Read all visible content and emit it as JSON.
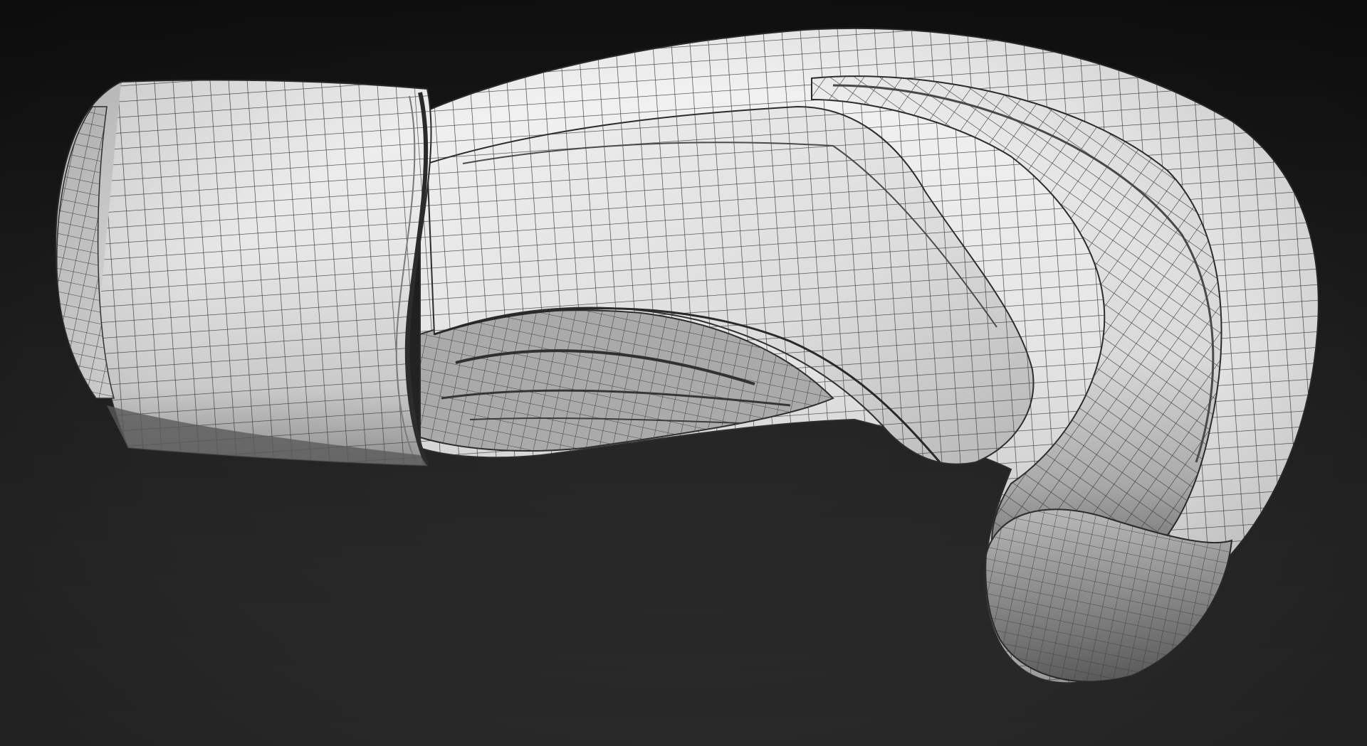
{
  "viewport": {
    "background_top": "#101010",
    "background_bottom": "#292929",
    "shading_mode": "polyframe"
  },
  "model": {
    "subject": "boxing-glove",
    "surface_color": "#e9e9e9",
    "wire_color": "#3a3a3a",
    "shadow_color": "#9a9a9a"
  }
}
